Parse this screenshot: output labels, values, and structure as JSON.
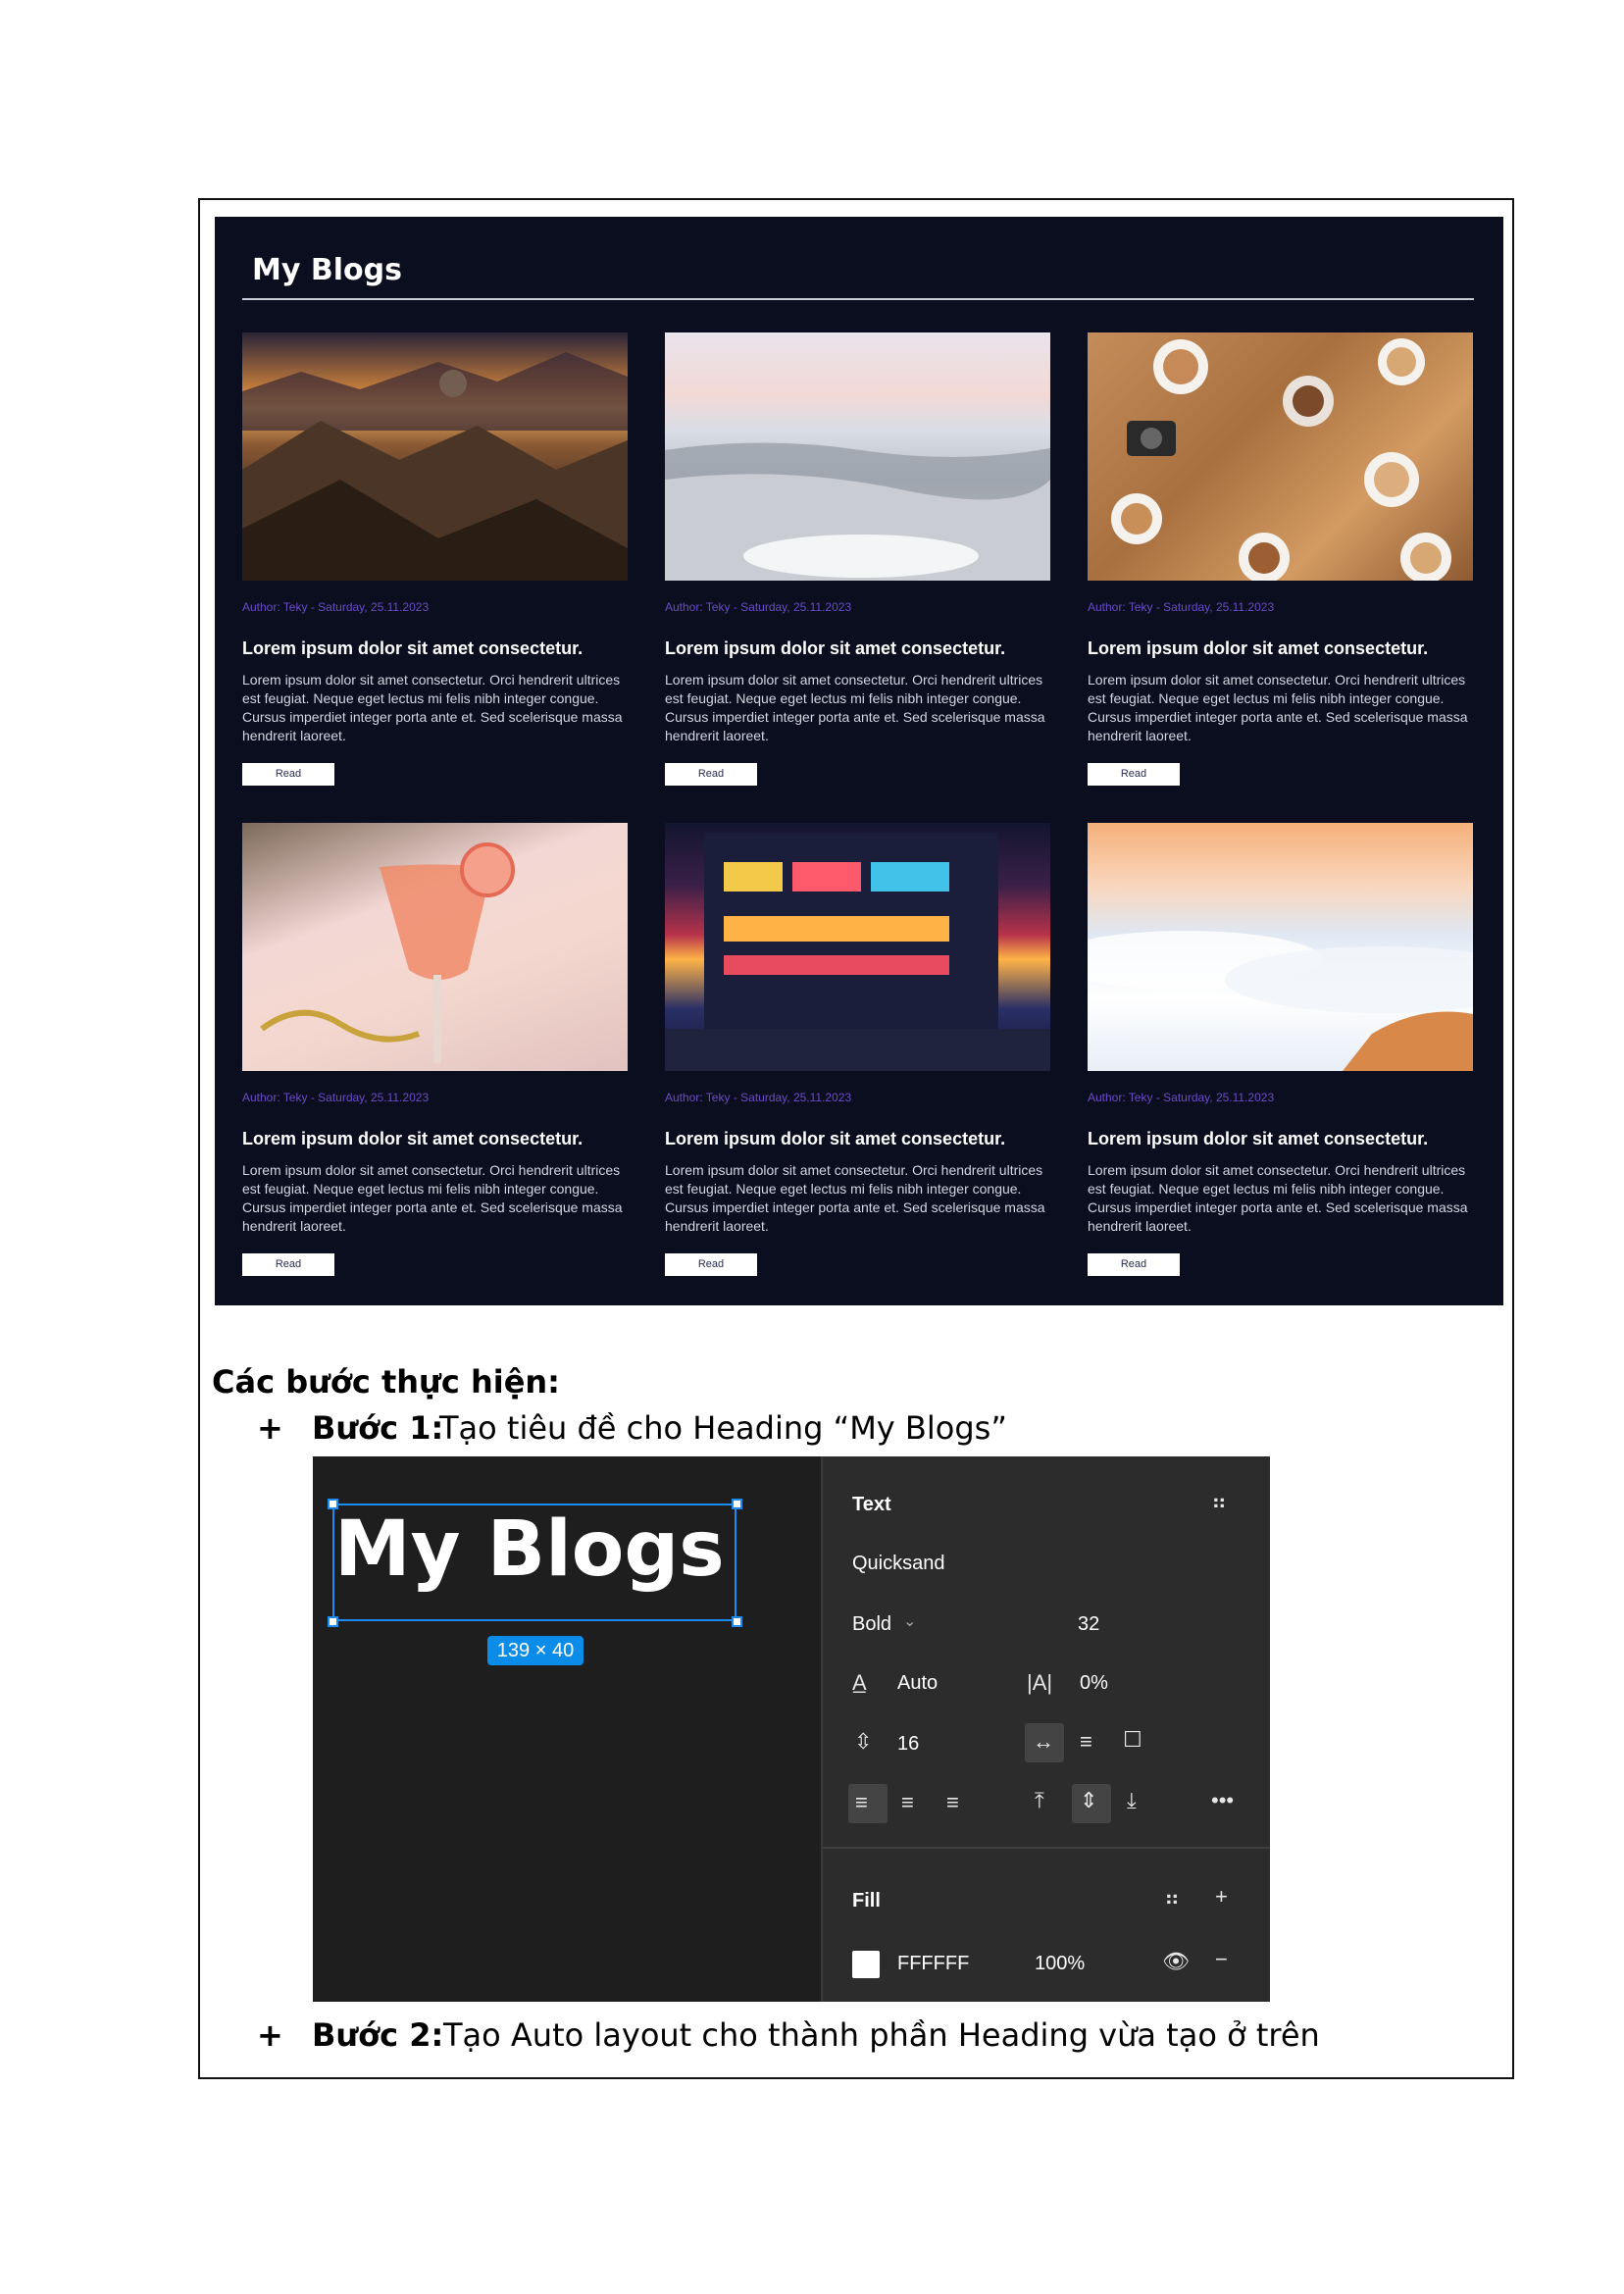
{
  "blog": {
    "title": "My Blogs",
    "cards": [
      {
        "image": "desert-mountains",
        "meta": "Author: Teky - Saturday, 25.11.2023",
        "title": "Lorem ipsum dolor sit amet consectetur.",
        "body": "Lorem ipsum dolor sit amet consectetur. Orci hendrerit ultrices est feugiat. Neque eget lectus mi felis nibh integer congue. Cursus imperdiet integer porta ante et. Sed scelerisque massa hendrerit laoreet.",
        "button": "Read"
      },
      {
        "image": "snowy-forest",
        "meta": "Author: Teky - Saturday, 25.11.2023",
        "title": "Lorem ipsum dolor sit amet consectetur.",
        "body": "Lorem ipsum dolor sit amet consectetur. Orci hendrerit ultrices est feugiat. Neque eget lectus mi felis nibh integer congue. Cursus imperdiet integer porta ante et. Sed scelerisque massa hendrerit laoreet.",
        "button": "Read"
      },
      {
        "image": "coffee-cups-table",
        "meta": "Author: Teky - Saturday, 25.11.2023",
        "title": "Lorem ipsum dolor sit amet consectetur.",
        "body": "Lorem ipsum dolor sit amet consectetur. Orci hendrerit ultrices est feugiat. Neque eget lectus mi felis nibh integer congue. Cursus imperdiet integer porta ante et. Sed scelerisque massa hendrerit laoreet.",
        "button": "Read"
      },
      {
        "image": "cocktail-happy-new-year",
        "meta": "Author: Teky - Saturday, 25.11.2023",
        "title": "Lorem ipsum dolor sit amet consectetur.",
        "body": "Lorem ipsum dolor sit amet consectetur. Orci hendrerit ultrices est feugiat. Neque eget lectus mi felis nibh integer congue. Cursus imperdiet integer porta ante et. Sed scelerisque massa hendrerit laoreet.",
        "button": "Read"
      },
      {
        "image": "city-night-street",
        "meta": "Author: Teky - Saturday, 25.11.2023",
        "title": "Lorem ipsum dolor sit amet consectetur.",
        "body": "Lorem ipsum dolor sit amet consectetur. Orci hendrerit ultrices est feugiat. Neque eget lectus mi felis nibh integer congue. Cursus imperdiet integer porta ante et. Sed scelerisque massa hendrerit laoreet.",
        "button": "Read"
      },
      {
        "image": "sea-of-clouds-sunrise",
        "meta": "Author: Teky - Saturday, 25.11.2023",
        "title": "Lorem ipsum dolor sit amet consectetur.",
        "body": "Lorem ipsum dolor sit amet consectetur. Orci hendrerit ultrices est feugiat. Neque eget lectus mi felis nibh integer congue. Cursus imperdiet integer porta ante et. Sed scelerisque massa hendrerit laoreet.",
        "button": "Read"
      }
    ]
  },
  "steps": {
    "heading": "Các bước thực hiện:",
    "plus": "+",
    "step1_label": "Bước 1:",
    "step1_text": "Tạo tiêu đề cho Heading “My Blogs”",
    "step2_label": "Bước 2:",
    "step2_text": "Tạo Auto layout cho thành phần Heading vừa tạo ở trên"
  },
  "figma": {
    "canvas_text": "My Blogs",
    "size_badge": "139 × 40",
    "panel": {
      "section_text": "Text",
      "font_family": "Quicksand",
      "font_weight": "Bold",
      "font_size": "32",
      "line_height": "Auto",
      "letter_spacing": "0%",
      "paragraph_spacing": "16",
      "section_fill": "Fill",
      "fill_hex": "FFFFFF",
      "fill_opacity": "100%"
    },
    "colors": {
      "selection": "#1d8cf0",
      "panel_bg": "#2c2c2c",
      "canvas_bg": "#1e1e1e"
    }
  },
  "colors": {
    "mock_bg": "#0b0e1f",
    "meta_text": "#6a4cc6"
  }
}
